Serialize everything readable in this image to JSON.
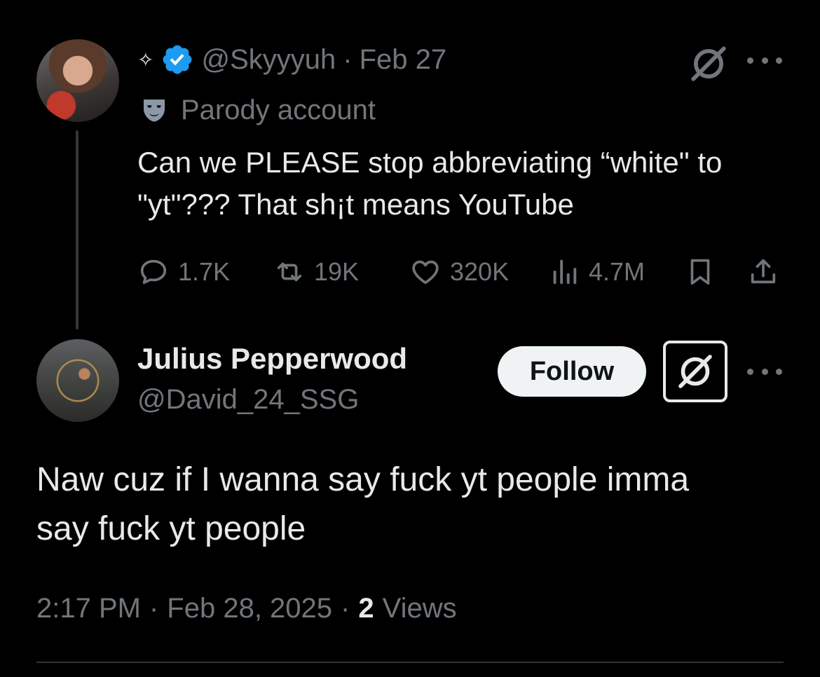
{
  "colors": {
    "background": "#000000",
    "primary_text": "#e7e9ea",
    "secondary_text": "#71767b",
    "verified_blue": "#1d9bf0",
    "follow_button_bg": "#eff3f4"
  },
  "parent_tweet": {
    "sparkle_glyph": "✧",
    "handle": "@Skyyyuh",
    "separator": "·",
    "date": "Feb 27",
    "parody_label": "Parody account",
    "text_line1": "Can we PLEASE stop abbreviating “white\" to",
    "text_line2": "\"yt\"??? That sh¡t means YouTube",
    "actions": {
      "replies": "1.7K",
      "reposts": "19K",
      "likes": "320K",
      "views": "4.7M"
    },
    "icons": [
      "verified-badge-icon",
      "parody-mask-icon",
      "grok-icon",
      "more-icon",
      "reply-icon",
      "repost-icon",
      "like-icon",
      "views-icon",
      "bookmark-icon",
      "share-icon"
    ]
  },
  "reply_tweet": {
    "display_name": "Julius Pepperwood",
    "handle": "@David_24_SSG",
    "follow_label": "Follow",
    "text_line1": "Naw cuz if I wanna say fuck yt people imma",
    "text_line2": "say fuck yt people",
    "time": "2:17 PM",
    "separator1": "·",
    "date": "Feb 28, 2025",
    "separator2": "·",
    "views_count": "2",
    "views_label": "Views"
  }
}
